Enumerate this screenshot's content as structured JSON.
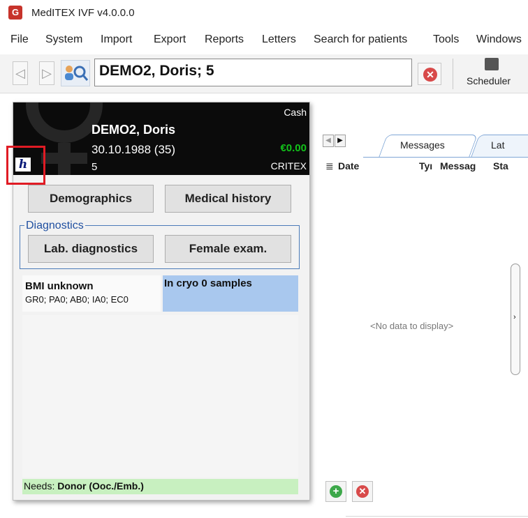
{
  "window": {
    "title": "MedITEX IVF v4.0.0.0"
  },
  "menu": [
    "File",
    "System",
    "Import",
    "Export",
    "Reports",
    "Letters",
    "Search for patients",
    "Tools",
    "Windows"
  ],
  "toolbar": {
    "patient_field": "DEMO2, Doris; 5",
    "scheduler_label": "Scheduler"
  },
  "patient_card": {
    "name": "DEMO2, Doris",
    "dob_age": "30.10.1988  (35)",
    "number": "5",
    "payment_type": "Cash",
    "balance": "€0.00",
    "insurer": "CRITEX",
    "logo_letter": "h",
    "buttons": {
      "demographics": "Demographics",
      "medical_history": "Medical history",
      "lab_diagnostics": "Lab. diagnostics",
      "female_exam": "Female exam."
    },
    "diagnostics_legend": "Diagnostics",
    "bmi": "BMI unknown",
    "obstetric_history": "GR0; PA0; AB0; IA0; EC0",
    "cryo": "In cryo 0 samples",
    "needs_label": "Needs:",
    "needs_value": "Donor (Ooc./Emb.)"
  },
  "right_panel": {
    "tabs": [
      "Messages",
      "Lat"
    ],
    "columns": [
      "Date",
      "Tyı",
      "Messag",
      "Sta"
    ],
    "empty_text": "<No data to display>"
  },
  "colors": {
    "header_bg": "#0b0b0b",
    "balance_green": "#12c21a",
    "cryo_blue": "#a9c8ee",
    "needs_green": "#c8f0c0",
    "highlight_red": "#e01b24"
  }
}
